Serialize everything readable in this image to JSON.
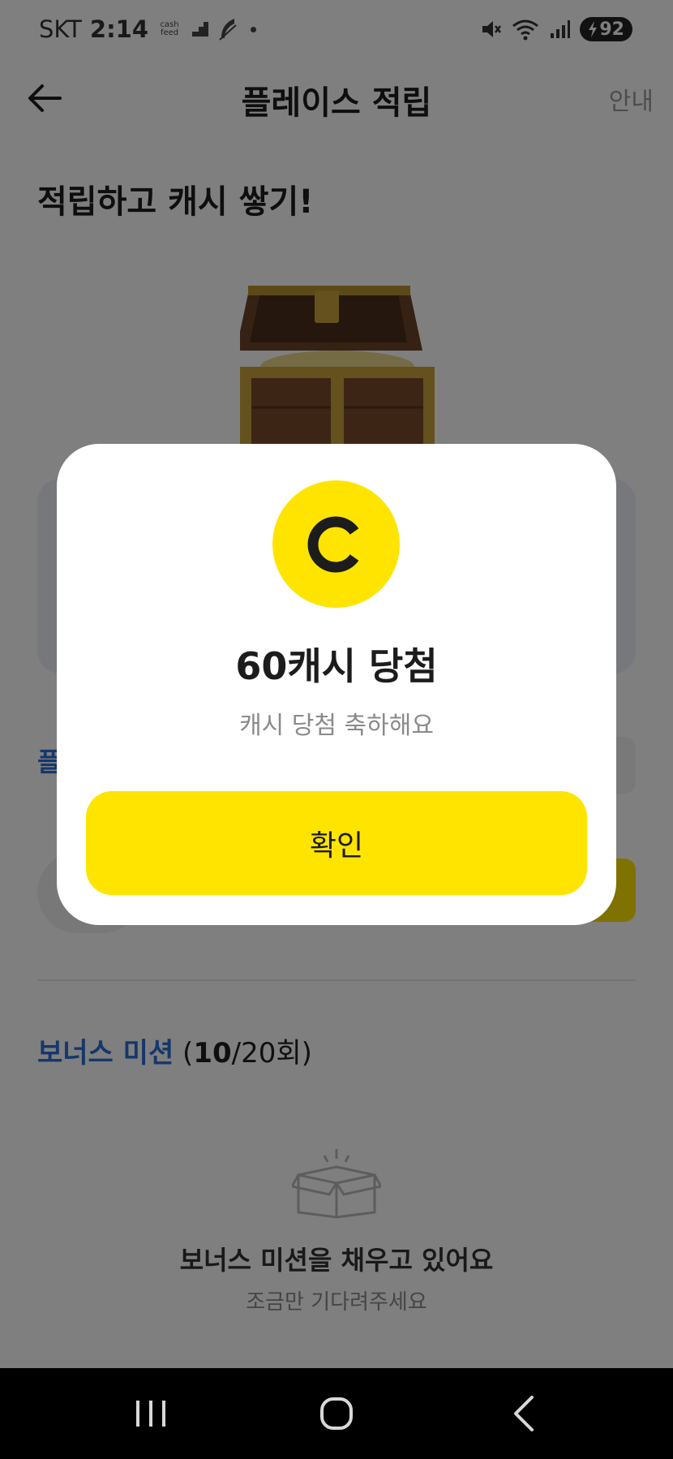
{
  "status_bar": {
    "carrier": "SKT",
    "time": "2:14",
    "app_badge": "cash feed",
    "battery_level": "92"
  },
  "header": {
    "title": "플레이스 적립",
    "info_label": "안내"
  },
  "hero": {
    "title": "적립하고 캐시 쌓기!"
  },
  "places_section": {
    "label_partial": "플"
  },
  "bonus": {
    "label": "보너스 미션",
    "count_open": " (",
    "count_done": "10",
    "count_total": "/20회)"
  },
  "empty_state": {
    "title": "보너스 미션을 채우고 있어요",
    "subtitle": "조금만 기다려주세요"
  },
  "modal": {
    "coin_icon": "cash-coin-icon",
    "title": "60캐시 당첨",
    "subtitle": "캐시 당첨 축하해요",
    "confirm_label": "확인"
  },
  "colors": {
    "brand_yellow": "#ffe400",
    "link_blue": "#2a6fd6",
    "overlay": "rgba(0,0,0,0.5)"
  }
}
